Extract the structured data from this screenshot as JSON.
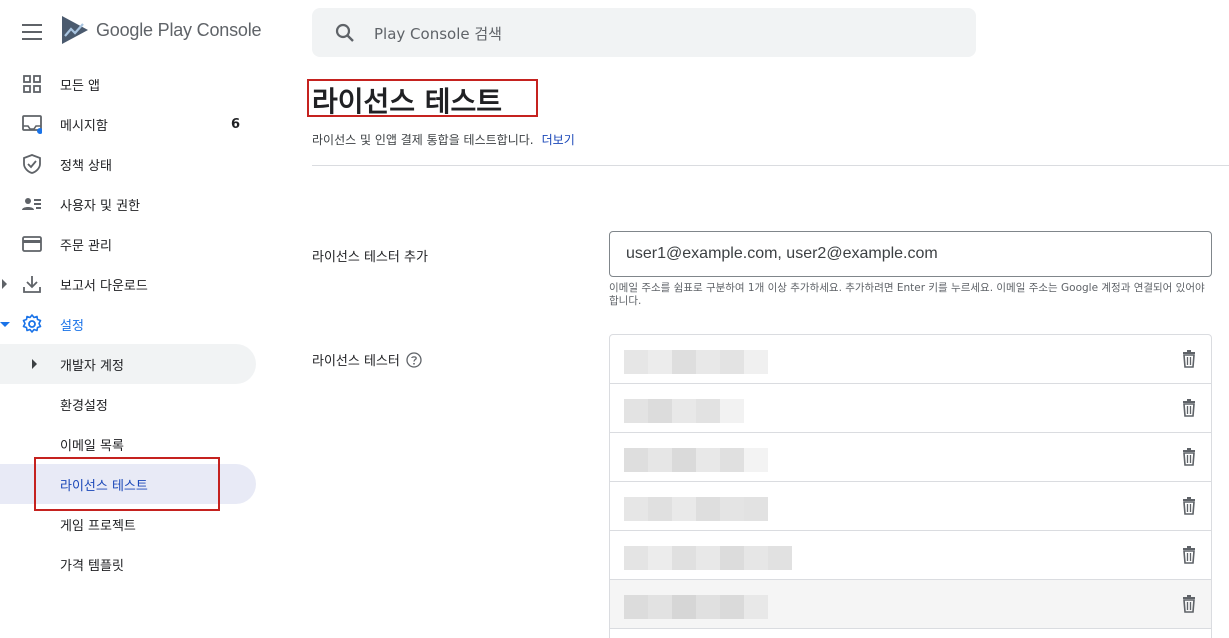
{
  "app": {
    "logo_text": "Google Play Console"
  },
  "search": {
    "placeholder": "Play Console 검색"
  },
  "sidebar": {
    "items": [
      {
        "label": "모든 앱",
        "icon": "grid-icon"
      },
      {
        "label": "메시지함",
        "icon": "inbox-icon",
        "badge": "6"
      },
      {
        "label": "정책 상태",
        "icon": "shield-check-icon"
      },
      {
        "label": "사용자 및 권한",
        "icon": "people-icon"
      },
      {
        "label": "주문 관리",
        "icon": "credit-card-icon"
      },
      {
        "label": "보고서 다운로드",
        "icon": "download-icon"
      },
      {
        "label": "설정",
        "icon": "gear-icon"
      }
    ],
    "settings_children": [
      {
        "label": "개발자 계정"
      },
      {
        "label": "환경설정"
      },
      {
        "label": "이메일 목록"
      },
      {
        "label": "라이선스 테스트"
      },
      {
        "label": "게임 프로젝트"
      },
      {
        "label": "가격 템플릿"
      }
    ]
  },
  "main": {
    "title": "라이선스 테스트",
    "description": "라이선스 및 인앱 결제 통합을 테스트합니다.",
    "learn_more": "더보기",
    "add_testers_label": "라이선스 테스터 추가",
    "email_input_value": "user1@example.com, user2@example.com",
    "email_hint": "이메일 주소를 쉼표로 구분하여 1개 이상 추가하세요. 추가하려면 Enter 키를 누르세요. 이메일 주소는 Google 계정과 연결되어 있어야 합니다.",
    "testers_label": "라이선스 테스터",
    "tester_rows_count": 6
  },
  "colors": {
    "accent": "#1a73e8",
    "highlight_box": "#c5221f",
    "selected_bg": "#e8eaf6"
  }
}
